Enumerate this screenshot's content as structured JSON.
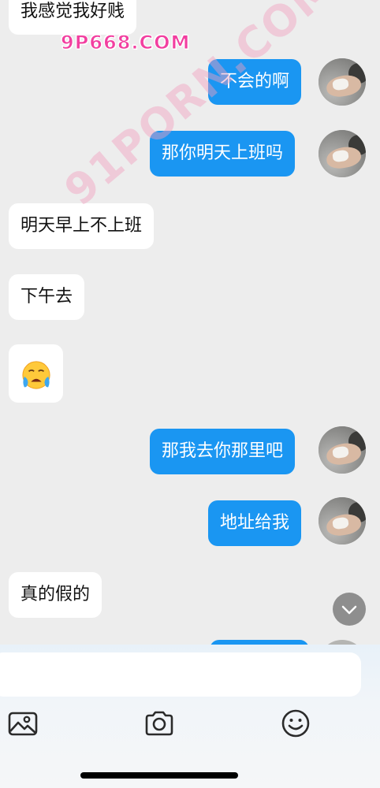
{
  "watermark": {
    "url": "9P668.COM",
    "diagonal": "91PORN.COM"
  },
  "messages": [
    {
      "side": "in",
      "text": "我感觉我好贱"
    },
    {
      "side": "out",
      "text": "不会的啊"
    },
    {
      "side": "out",
      "text": "那你明天上班吗"
    },
    {
      "side": "in",
      "text": "明天早上不上班"
    },
    {
      "side": "in",
      "text": "下午去"
    },
    {
      "side": "in",
      "type": "emoji",
      "icon": "crying-face-emoji-icon"
    },
    {
      "side": "out",
      "text": "那我去你那里吧"
    },
    {
      "side": "out",
      "text": "地址给我"
    },
    {
      "side": "in",
      "text": "真的假的"
    }
  ],
  "scroll_down_icon": "chevron-down-icon",
  "input": {
    "value": "",
    "placeholder": ""
  },
  "toolbar": {
    "icons": [
      "image-icon",
      "camera-icon",
      "emoji-icon"
    ]
  },
  "colors": {
    "outgoing_bubble": "#1a96f2",
    "incoming_bubble": "#ffffff",
    "chat_background": "#ededed",
    "watermark": "#f23fa0"
  }
}
